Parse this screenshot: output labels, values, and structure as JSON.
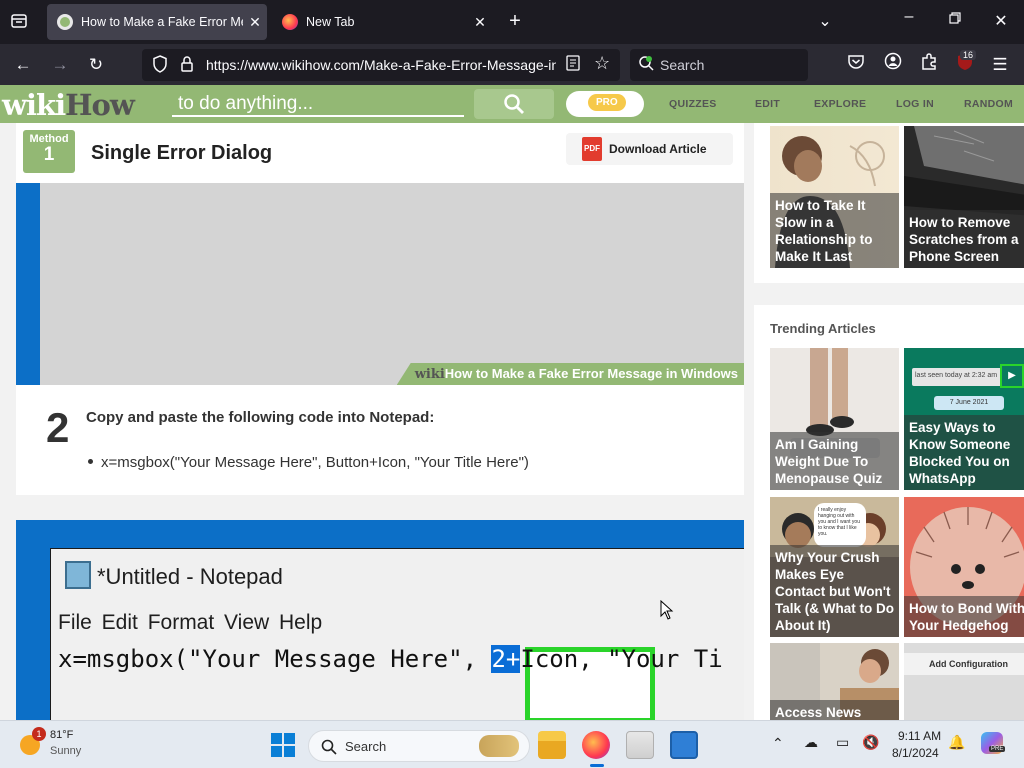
{
  "browser": {
    "tabs": [
      {
        "title": "How to Make a Fake Error Message",
        "active": true
      },
      {
        "title": "New Tab",
        "active": false
      }
    ],
    "url": "https://www.wikihow.com/Make-a-Fake-Error-Message-in",
    "search_placeholder": "Search",
    "extension_badge": "16"
  },
  "site": {
    "logo_wiki": "wiki",
    "logo_how": "How",
    "search_placeholder": "to do anything...",
    "pro": "PRO",
    "nav": [
      "QUIZZES",
      "EDIT",
      "EXPLORE",
      "LOG IN",
      "RANDOM"
    ]
  },
  "article": {
    "method_label": "Method",
    "method_number": "1",
    "section_title": "Single Error Dialog",
    "download_label": "Download Article",
    "pdf_icon_text": "PDF",
    "watermark_wiki": "wiki",
    "watermark_how": "How",
    "watermark_text": " to Make a Fake Error Message in Windows",
    "step_number": "2",
    "step_text": "Copy and paste the following code into Notepad:",
    "bullet": "x=msgbox(\"Your Message Here\", Button+Icon, \"Your Title Here\")",
    "notepad": {
      "title": "*Untitled - Notepad",
      "menu": "File Edit Format View Help",
      "code_before": "x=msgbox(\"Your Message Here\", ",
      "code_selected": "2+",
      "code_after": "Icon, \"Your Ti"
    }
  },
  "sidebar": {
    "top_cards": [
      {
        "label": "How to Take It Slow in a Relationship to Make It Last"
      },
      {
        "label": "How to Remove Scratches from a Phone Screen"
      }
    ],
    "trending_title": "Trending Articles",
    "trending": [
      {
        "label": "Am I Gaining Weight Due To Menopause Quiz"
      },
      {
        "label": "Easy Ways to Know Someone Blocked You on WhatsApp"
      },
      {
        "label": "Why Your Crush Makes Eye Contact but Won't Talk (& What to Do About It)"
      },
      {
        "label": "How to Bond With Your Hedgehog"
      },
      {
        "label": "Access News Articles for Free"
      },
      {
        "label": "Add Configuration"
      }
    ],
    "chat_lines": [
      "last seen today at 2:32 am",
      "7 June 2021"
    ],
    "comic_text": "I really enjoy hanging out with you and I want you to know that I like you."
  },
  "taskbar": {
    "weather_temp": "81°F",
    "weather_desc": "Sunny",
    "weather_badge": "1",
    "search_label": "Search",
    "time": "9:11 AM",
    "date": "8/1/2024",
    "copilot_badge": "PRE"
  },
  "colors": {
    "wikihow_green": "#93b874",
    "tab_dark": "#1c1b22",
    "selection_blue": "#0a6dd6",
    "highlight_green": "#2ad42a"
  }
}
